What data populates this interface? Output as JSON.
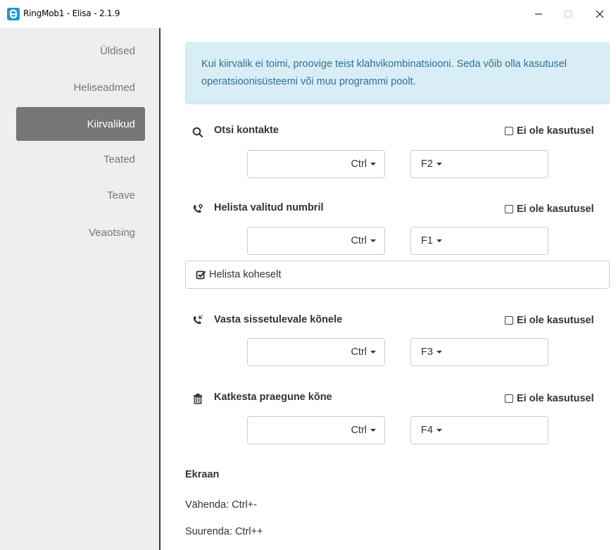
{
  "window": {
    "title": "RingMob1 - Elisa - 2.1.9",
    "logo_icon": "elisa-logo-icon",
    "controls": [
      "minimize",
      "maximize",
      "close"
    ]
  },
  "sidebar": {
    "items": [
      {
        "label": "Üldised",
        "active": false
      },
      {
        "label": "Heliseadmed",
        "active": false
      },
      {
        "label": "Kiirvalikud",
        "active": true
      },
      {
        "label": "Teated",
        "active": false
      },
      {
        "label": "Teave",
        "active": false
      },
      {
        "label": "Veaotsing",
        "active": false
      }
    ]
  },
  "alert": {
    "text": "Kui kiirvalik ei toimi, proovige teist klahvikombinatsiooni. Seda võib olla kasutusel operatsioonisüsteemi või muu programmi poolt."
  },
  "shortcuts": [
    {
      "title": "Otsi kontakte",
      "icon": "search-icon",
      "disabled_label": "Ei ole kasutusel",
      "disabled": false,
      "modifier": "Ctrl",
      "key": "F2"
    },
    {
      "title": "Helista valitud numbril",
      "icon": "phone-call-icon",
      "disabled_label": "Ei ole kasutusel",
      "disabled": false,
      "modifier": "Ctrl",
      "key": "F1"
    },
    {
      "title": "Vasta sissetulevale kõnele",
      "icon": "phone-incoming-icon",
      "disabled_label": "Ei ole kasutusel",
      "disabled": false,
      "modifier": "Ctrl",
      "key": "F3"
    },
    {
      "title": "Katkesta praegune kõne",
      "icon": "trash-icon",
      "disabled_label": "Ei ole kasutusel",
      "disabled": false,
      "modifier": "Ctrl",
      "key": "F4"
    }
  ],
  "call_immediately": {
    "label": "Helista koheselt",
    "icon": "check-square-icon",
    "checked": true
  },
  "screen": {
    "title": "Ekraan",
    "zoom_out": "Vähenda: Ctrl+-",
    "zoom_in": "Suurenda: Ctrl++"
  },
  "colors": {
    "accent_active": "#777777",
    "alert_bg": "#d9edf7",
    "alert_text": "#31708f"
  }
}
